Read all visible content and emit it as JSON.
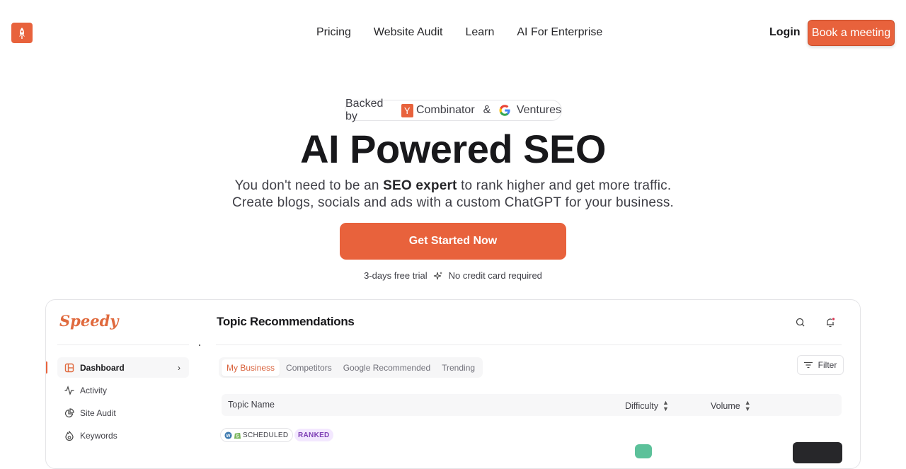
{
  "nav": {
    "logo_icon": "rocket-icon",
    "links": [
      "Pricing",
      "Website Audit",
      "Learn",
      "AI For Enterprise"
    ],
    "login_label": "Login",
    "book_label": "Book a meeting"
  },
  "hero": {
    "backed_prefix": "Backed by",
    "yc_letter": "Y",
    "yc_name": "Combinator",
    "amp": "&",
    "google_name": "Ventures",
    "title": "AI Powered SEO",
    "sub_line1_a": "You don't need to be an",
    "sub_line1_bold": "SEO expert",
    "sub_line1_b": "to rank higher and get more traffic.",
    "sub_line2": "Create blogs, socials and ads with a custom ChatGPT for your business.",
    "cta_label": "Get Started Now",
    "trial_text": "3-days free trial",
    "trial_icon": "sparkle-icon",
    "no_card_text": "No credit card required"
  },
  "app": {
    "brand": "Speedy",
    "sidebar": [
      {
        "label": "Dashboard",
        "icon": "layout-icon",
        "active": true
      },
      {
        "label": "Activity",
        "icon": "activity-icon",
        "active": false
      },
      {
        "label": "Site Audit",
        "icon": "pie-chart-icon",
        "active": false
      },
      {
        "label": "Keywords",
        "icon": "flame-icon",
        "active": false
      }
    ],
    "title": "Topic Recommendations",
    "tabs": [
      "My Business",
      "Competitors",
      "Google Recommended",
      "Trending"
    ],
    "active_tab": "My Business",
    "filter_label": "Filter",
    "table": {
      "columns": [
        "Topic Name",
        "Difficulty",
        "Volume"
      ],
      "row1": {
        "status_badge": "SCHEDULED",
        "rank_badge": "RANKED"
      }
    }
  },
  "colors": {
    "brand": "#e8623c",
    "ranked_bg": "#f3e8ff",
    "ranked_text": "#7e3fb5"
  }
}
